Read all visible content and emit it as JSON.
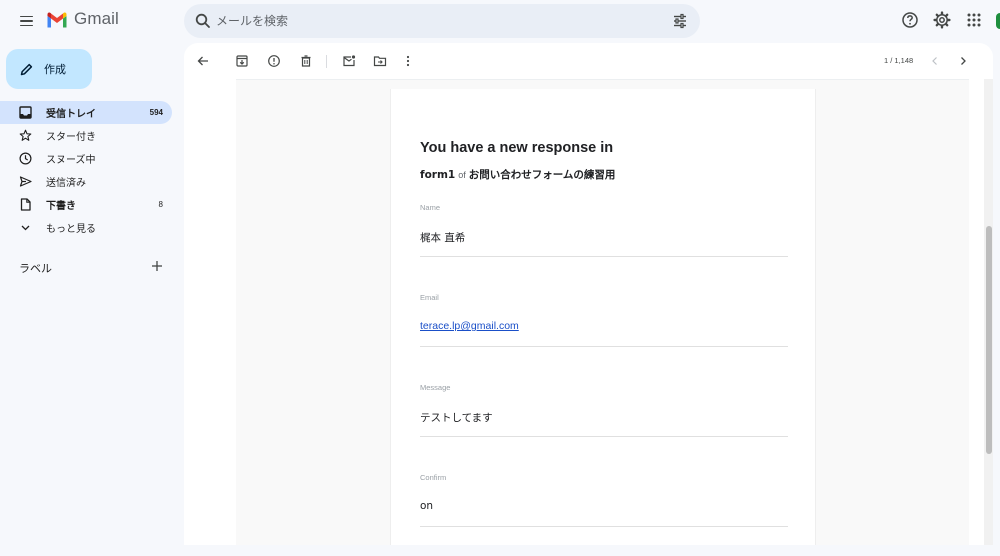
{
  "app": {
    "name": "Gmail"
  },
  "search": {
    "placeholder": "メールを検索"
  },
  "sidebar": {
    "compose_label": "作成",
    "items": [
      {
        "label": "受信トレイ",
        "count": "594",
        "icon": "inbox-icon",
        "active": true,
        "bold": true
      },
      {
        "label": "スター付き",
        "count": "",
        "icon": "star-icon",
        "active": false,
        "bold": false
      },
      {
        "label": "スヌーズ中",
        "count": "",
        "icon": "clock-icon",
        "active": false,
        "bold": false
      },
      {
        "label": "送信済み",
        "count": "",
        "icon": "send-icon",
        "active": false,
        "bold": false
      },
      {
        "label": "下書き",
        "count": "8",
        "icon": "draft-icon",
        "active": false,
        "bold": true
      },
      {
        "label": "もっと見る",
        "count": "",
        "icon": "chevron-down-icon",
        "active": false,
        "bold": false
      }
    ],
    "labels_header": "ラベル"
  },
  "toolbar": {
    "pager": "1 / 1,148",
    "icons": [
      "back-arrow-icon",
      "archive-icon",
      "report-spam-icon",
      "delete-icon",
      "mark-unread-icon",
      "move-to-icon",
      "more-vert-icon"
    ]
  },
  "message": {
    "title": "You have a new response in",
    "form_name": "form1",
    "of_text": "of",
    "form_title": "お問い合わせフォームの練習用",
    "fields": [
      {
        "label": "Name",
        "value": "梶本 直希",
        "link": false
      },
      {
        "label": "Email",
        "value": "terace.lp@gmail.com",
        "link": true
      },
      {
        "label": "Message",
        "value": "テストしてます",
        "link": false
      },
      {
        "label": "Confirm",
        "value": "on",
        "link": false
      }
    ]
  },
  "colors": {
    "background": "#f6f8fc",
    "compose": "#c2e7ff",
    "active_nav": "#d3e3fd",
    "search": "#e9eef6",
    "link": "#1a4fc8"
  }
}
